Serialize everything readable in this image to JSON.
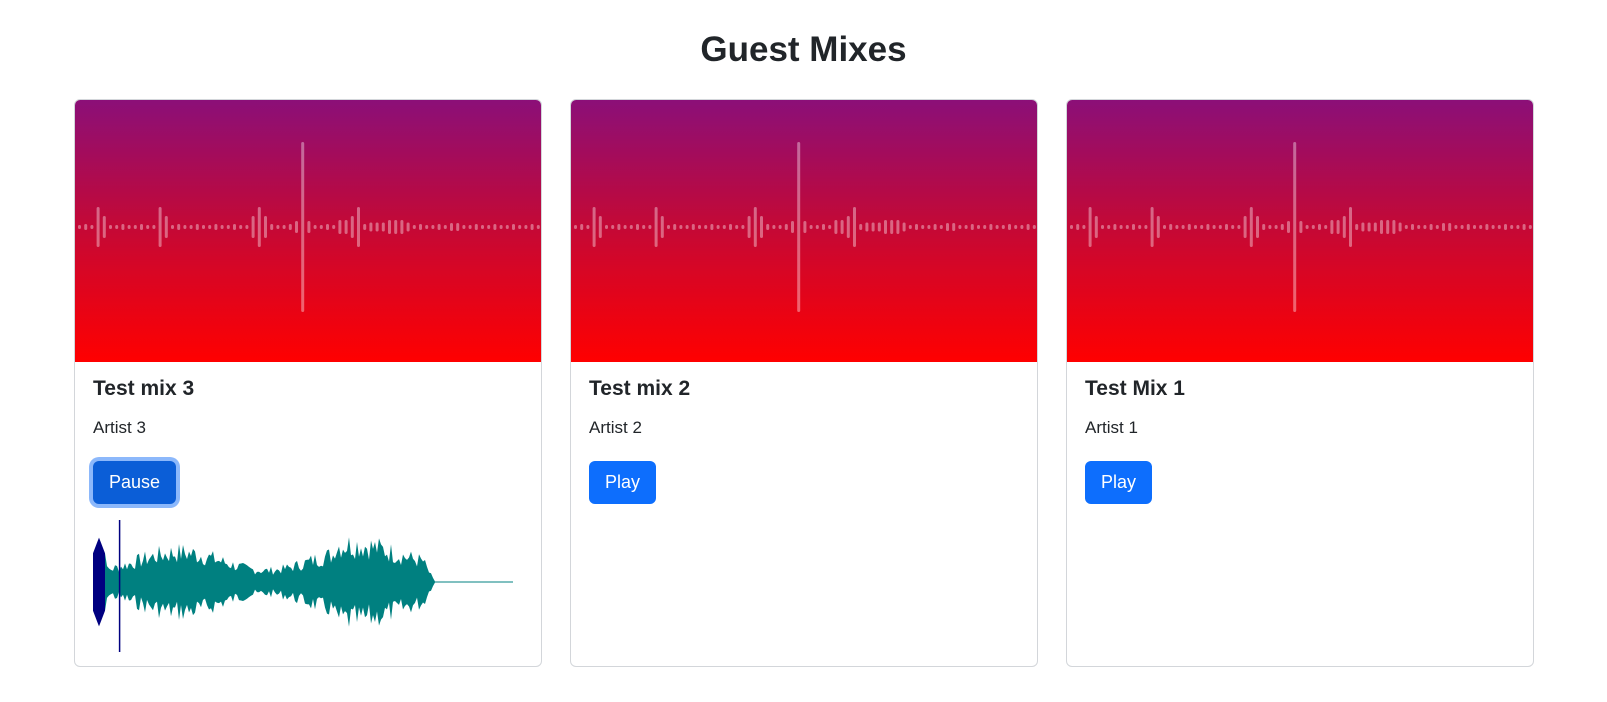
{
  "page": {
    "title": "Guest Mixes"
  },
  "cards": [
    {
      "title": "Test mix 3",
      "artist": "Artist 3",
      "button_label": "Pause",
      "playing": true,
      "progress": 0.03
    },
    {
      "title": "Test mix 2",
      "artist": "Artist 2",
      "button_label": "Play",
      "playing": false
    },
    {
      "title": "Test Mix 1",
      "artist": "Artist 1",
      "button_label": "Play",
      "playing": false
    }
  ],
  "colors": {
    "cover_top": "#8b0f78",
    "cover_bottom": "#ff0000",
    "button": "#0d6efd",
    "wave": "#008080",
    "wave_progress": "#000080"
  },
  "icons": {
    "cover_art": "waveform-cover-art"
  }
}
